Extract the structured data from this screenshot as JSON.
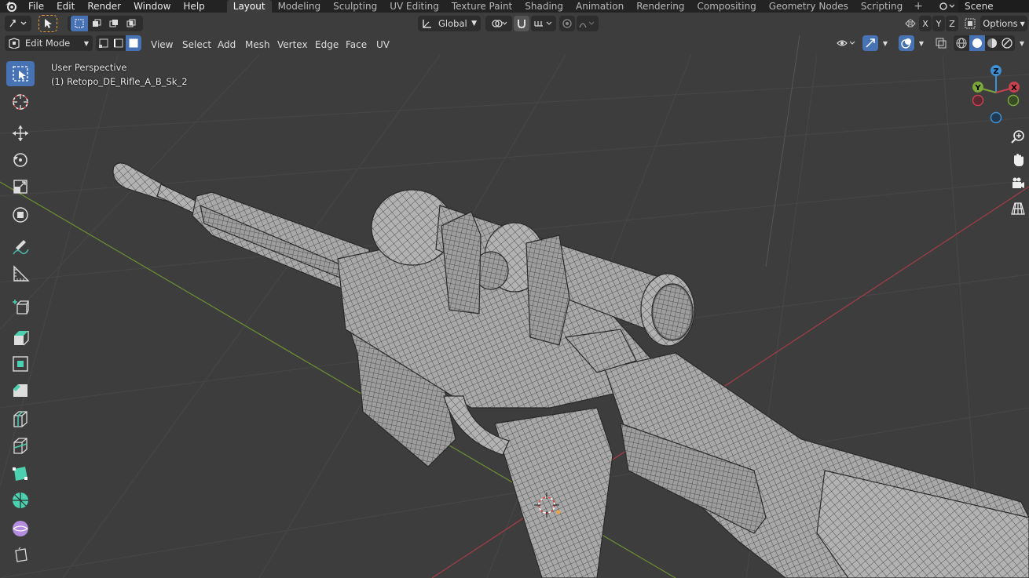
{
  "topbar": {
    "menus": [
      "File",
      "Edit",
      "Render",
      "Window",
      "Help"
    ],
    "workspaces": [
      "Layout",
      "Modeling",
      "Sculpting",
      "UV Editing",
      "Texture Paint",
      "Shading",
      "Animation",
      "Rendering",
      "Compositing",
      "Geometry Nodes",
      "Scripting"
    ],
    "active_workspace": "Layout",
    "scene_name": "Scene"
  },
  "header": {
    "transform_orientation": "Global",
    "axis_x": "X",
    "axis_y": "Y",
    "axis_z": "Z",
    "options_label": "Options"
  },
  "edit_header": {
    "mode": "Edit Mode",
    "menus": [
      "View",
      "Select",
      "Add",
      "Mesh",
      "Vertex",
      "Edge",
      "Face",
      "UV"
    ]
  },
  "viewport": {
    "perspective_label": "User Perspective",
    "object_label": "(1) Retopo_DE_Rifle_A_B_Sk_2",
    "gizmo_x": "X",
    "gizmo_y": "Y",
    "gizmo_z": "Z"
  },
  "colors": {
    "accent": "#4772b3",
    "viewport_bg": "#3d3d3d",
    "x_axis": "#c8414e",
    "y_axis": "#7aa83a",
    "z_axis": "#3d8fd6",
    "mesh": "#a9a9a9",
    "wire": "#2f2f2f"
  },
  "toolbar_icons": [
    "select-box-icon",
    "cursor-icon",
    "move-icon",
    "rotate-icon",
    "scale-icon",
    "transform-icon",
    "annotate-icon",
    "measure-icon",
    "add-cube-icon",
    "extrude-icon",
    "inset-icon",
    "bevel-icon",
    "loop-cut-icon",
    "knife-icon",
    "poly-build-icon",
    "spin-icon",
    "smooth-icon",
    "shear-icon"
  ]
}
